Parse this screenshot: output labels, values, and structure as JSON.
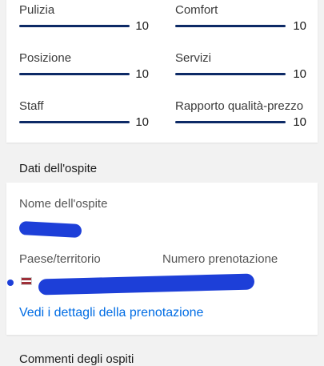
{
  "ratings": {
    "pulizia": {
      "label": "Pulizia",
      "value": "10",
      "fill": 1.0
    },
    "comfort": {
      "label": "Comfort",
      "value": "10",
      "fill": 1.0
    },
    "posizione": {
      "label": "Posizione",
      "value": "10",
      "fill": 1.0
    },
    "servizi": {
      "label": "Servizi",
      "value": "10",
      "fill": 1.0
    },
    "staff": {
      "label": "Staff",
      "value": "10",
      "fill": 1.0
    },
    "rapporto": {
      "label": "Rapporto qualità-prezzo",
      "value": "10",
      "fill": 1.0
    }
  },
  "guest_section": {
    "heading": "Dati dell'ospite",
    "name_label": "Nome dell'ospite",
    "country_label": "Paese/territorio",
    "booking_label": "Numero prenotazione",
    "details_link": "Vedi i dettagli della prenotazione"
  },
  "comments_section": {
    "heading": "Commenti degli ospiti"
  },
  "colors": {
    "bar": "#0d2a66",
    "link": "#006ce4",
    "redaction": "#1d3fd8"
  }
}
